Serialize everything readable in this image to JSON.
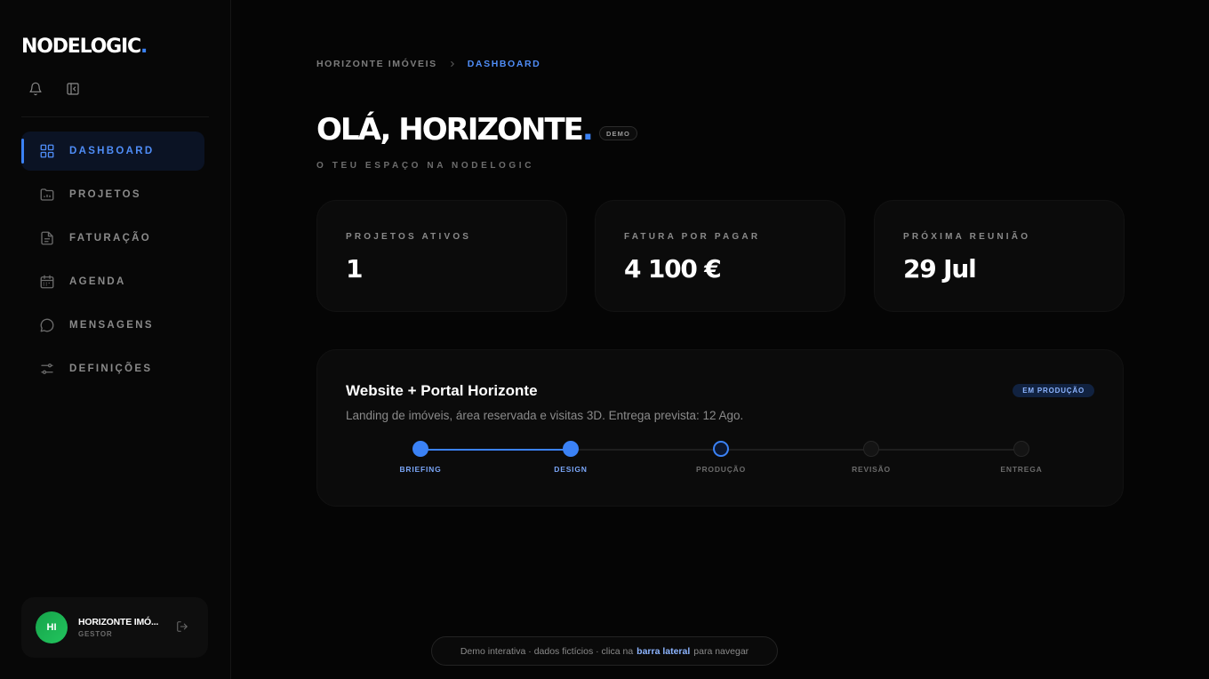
{
  "brand": {
    "name": "NODELOGIC",
    "dot": ".",
    "accent": "#3b82f6"
  },
  "sidebar": {
    "top_icons": [
      "bell-icon",
      "sidebar-collapse-icon"
    ],
    "items": [
      {
        "label": "DASHBOARD",
        "icon": "grid-icon",
        "active": true
      },
      {
        "label": "PROJETOS",
        "icon": "folder-icon",
        "active": false
      },
      {
        "label": "FATURAÇÃO",
        "icon": "document-icon",
        "active": false
      },
      {
        "label": "AGENDA",
        "icon": "calendar-icon",
        "active": false
      },
      {
        "label": "MENSAGENS",
        "icon": "chat-icon",
        "active": false
      },
      {
        "label": "DEFINIÇÕES",
        "icon": "sliders-icon",
        "active": false
      }
    ],
    "user": {
      "initials": "HI",
      "name": "HORIZONTE IMÓ...",
      "role": "GESTOR",
      "avatar_color": "#22c55e"
    }
  },
  "breadcrumb": {
    "parent": "HORIZONTE IMÓVEIS",
    "current": "DASHBOARD"
  },
  "header": {
    "title": "OLÁ, HORIZONTE",
    "title_dot": ".",
    "badge": "DEMO",
    "subtitle": "O TEU ESPAÇO NA NODELOGIC"
  },
  "stats": [
    {
      "label": "PROJETOS ATIVOS",
      "value": "1"
    },
    {
      "label": "FATURA POR PAGAR",
      "value": "4 100 €"
    },
    {
      "label": "PRÓXIMA REUNIÃO",
      "value": "29 Jul"
    }
  ],
  "project": {
    "title": "Website + Portal Horizonte",
    "description": "Landing de imóveis, área reservada e visitas 3D. Entrega prevista: 12 Ago.",
    "status": "EM PRODUÇÃO",
    "steps": [
      {
        "label": "BRIEFING",
        "state": "done"
      },
      {
        "label": "DESIGN",
        "state": "done"
      },
      {
        "label": "PRODUÇÃO",
        "state": "current"
      },
      {
        "label": "REVISÃO",
        "state": "pending"
      },
      {
        "label": "ENTREGA",
        "state": "pending"
      }
    ]
  },
  "footer": {
    "prefix": "Demo interativa · dados fictícios · clica na",
    "highlight": "barra lateral",
    "suffix": "para navegar"
  }
}
